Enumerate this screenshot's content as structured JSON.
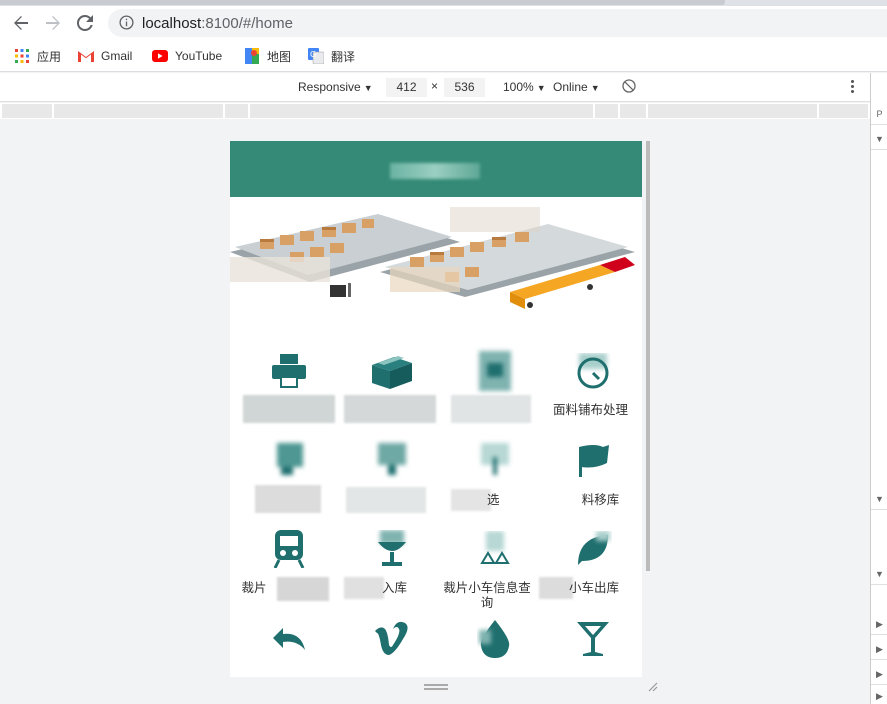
{
  "browser": {
    "url_host": "localhost",
    "url_rest": ":8100/#/home",
    "bookmarks": [
      {
        "label": "应用",
        "icon": "apps-grid-icon"
      },
      {
        "label": "Gmail",
        "icon": "gmail-icon"
      },
      {
        "label": "YouTube",
        "icon": "youtube-icon"
      },
      {
        "label": "地图",
        "icon": "maps-icon"
      },
      {
        "label": "翻译",
        "icon": "translate-icon"
      }
    ]
  },
  "device_toolbar": {
    "device": "Responsive",
    "width": "412",
    "times": "×",
    "height": "536",
    "zoom": "100%",
    "network": "Online"
  },
  "app": {
    "colors": {
      "header": "#348a76",
      "icon": "#1f6f6f"
    },
    "menu": [
      {
        "label": "",
        "icon": "printer-icon"
      },
      {
        "label": "",
        "icon": "box-icon"
      },
      {
        "label": "",
        "icon": "document-icon"
      },
      {
        "label": "面料铺布处理",
        "icon": "clock-icon"
      },
      {
        "label": "",
        "icon": "tool-icon"
      },
      {
        "label": "",
        "icon": "shelf-up-icon"
      },
      {
        "label": "选",
        "icon": "filter-icon"
      },
      {
        "label": "料移库",
        "icon": "flag-icon"
      },
      {
        "label": "裁片",
        "icon": "train-icon"
      },
      {
        "label": "入库",
        "icon": "trophy-icon"
      },
      {
        "label": "裁片小车信息查询",
        "icon": "recycle-icon"
      },
      {
        "label": "小车出库",
        "icon": "leaf-icon"
      },
      {
        "label": "",
        "icon": "undo-icon"
      },
      {
        "label": "",
        "icon": "vimeo-icon"
      },
      {
        "label": "",
        "icon": "drop-icon"
      },
      {
        "label": "",
        "icon": "cocktail-icon"
      }
    ]
  }
}
